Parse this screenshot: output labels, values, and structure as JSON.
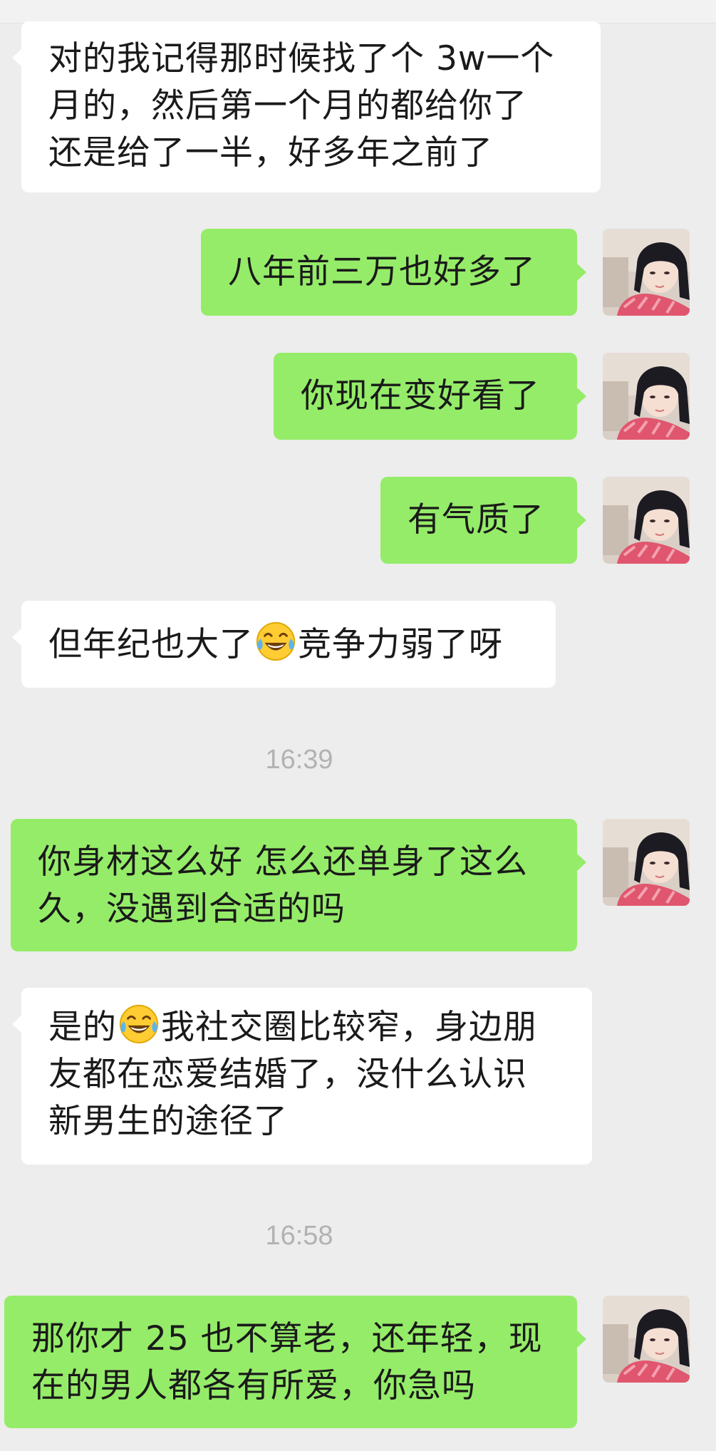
{
  "messages": [
    {
      "side": "left",
      "lines": [
        "对的我记得那时候找了个 3w一个",
        "月的，然后第一个月的都给你了",
        "还是给了一半，好多年之前了"
      ]
    },
    {
      "side": "right",
      "lines": [
        "八年前三万也好多了"
      ]
    },
    {
      "side": "right",
      "lines": [
        "你现在变好看了"
      ]
    },
    {
      "side": "right",
      "lines": [
        "有气质了"
      ]
    },
    {
      "side": "left",
      "before_emoji": "但年纪也大了",
      "emoji": "face-with-tears-of-joy",
      "after_emoji": "竞争力弱了呀"
    },
    {
      "side": "right",
      "lines": [
        "你身材这么好 怎么还单身了这么",
        "久，没遇到合适的吗"
      ]
    },
    {
      "side": "left",
      "first_before_emoji": "是的",
      "emoji": "face-with-tears-of-joy",
      "first_after_emoji": "我社交圈比较窄，身边朋",
      "lines": [
        "友都在恋爱结婚了，没什么认识",
        "新男生的途径了"
      ]
    },
    {
      "side": "right",
      "lines": [
        "那你才 25 也不算老，还年轻，现",
        "在的男人都各有所爱，你急吗"
      ]
    }
  ],
  "timestamps": [
    "16:39",
    "16:58"
  ],
  "avatar_icon": "user-photo-avatar",
  "colors": {
    "background": "#ededed",
    "sent_bubble": "#95ec69",
    "received_bubble": "#ffffff",
    "timestamp": "#b2b2b2"
  }
}
